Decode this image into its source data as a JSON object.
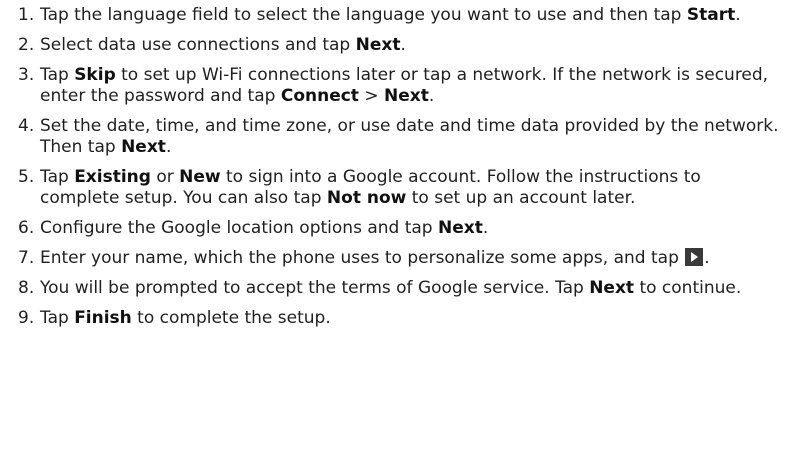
{
  "steps": [
    {
      "number": "1.",
      "parts": [
        {
          "text": "Tap the language field to select the language you want to use and then tap "
        },
        {
          "text": "Start",
          "bold": true
        },
        {
          "text": "."
        }
      ]
    },
    {
      "number": "2.",
      "parts": [
        {
          "text": "Select data use connections and tap "
        },
        {
          "text": "Next",
          "bold": true
        },
        {
          "text": "."
        }
      ]
    },
    {
      "number": "3.",
      "parts": [
        {
          "text": "Tap "
        },
        {
          "text": "Skip",
          "bold": true
        },
        {
          "text": " to set up Wi-Fi connections later or tap a network. If the network is secured, enter the password and tap "
        },
        {
          "text": "Connect",
          "bold": true
        },
        {
          "text": " > "
        },
        {
          "text": "Next",
          "bold": true
        },
        {
          "text": "."
        }
      ]
    },
    {
      "number": "4.",
      "parts": [
        {
          "text": "Set the date, time, and time zone, or use date and time data provided by the network. Then tap "
        },
        {
          "text": "Next",
          "bold": true
        },
        {
          "text": "."
        }
      ]
    },
    {
      "number": "5.",
      "parts": [
        {
          "text": "Tap "
        },
        {
          "text": "Existing",
          "bold": true
        },
        {
          "text": " or "
        },
        {
          "text": "New",
          "bold": true
        },
        {
          "text": " to sign into a Google account. Follow the instructions to complete setup. You can also tap "
        },
        {
          "text": "Not now",
          "bold": true
        },
        {
          "text": " to set up an account later."
        }
      ]
    },
    {
      "number": "6.",
      "parts": [
        {
          "text": "Configure the Google location options and tap "
        },
        {
          "text": "Next",
          "bold": true
        },
        {
          "text": "."
        }
      ]
    },
    {
      "number": "7.",
      "parts": [
        {
          "text": "Enter your name, which the phone uses to personalize some apps, and tap "
        },
        {
          "icon": "play-icon"
        },
        {
          "text": "."
        }
      ]
    },
    {
      "number": "8.",
      "parts": [
        {
          "text": "You will be prompted to accept the terms of Google service. Tap "
        },
        {
          "text": "Next",
          "bold": true
        },
        {
          "text": " to continue."
        }
      ]
    },
    {
      "number": "9.",
      "parts": [
        {
          "text": "Tap "
        },
        {
          "text": "Finish",
          "bold": true
        },
        {
          "text": " to complete the setup."
        }
      ]
    }
  ]
}
